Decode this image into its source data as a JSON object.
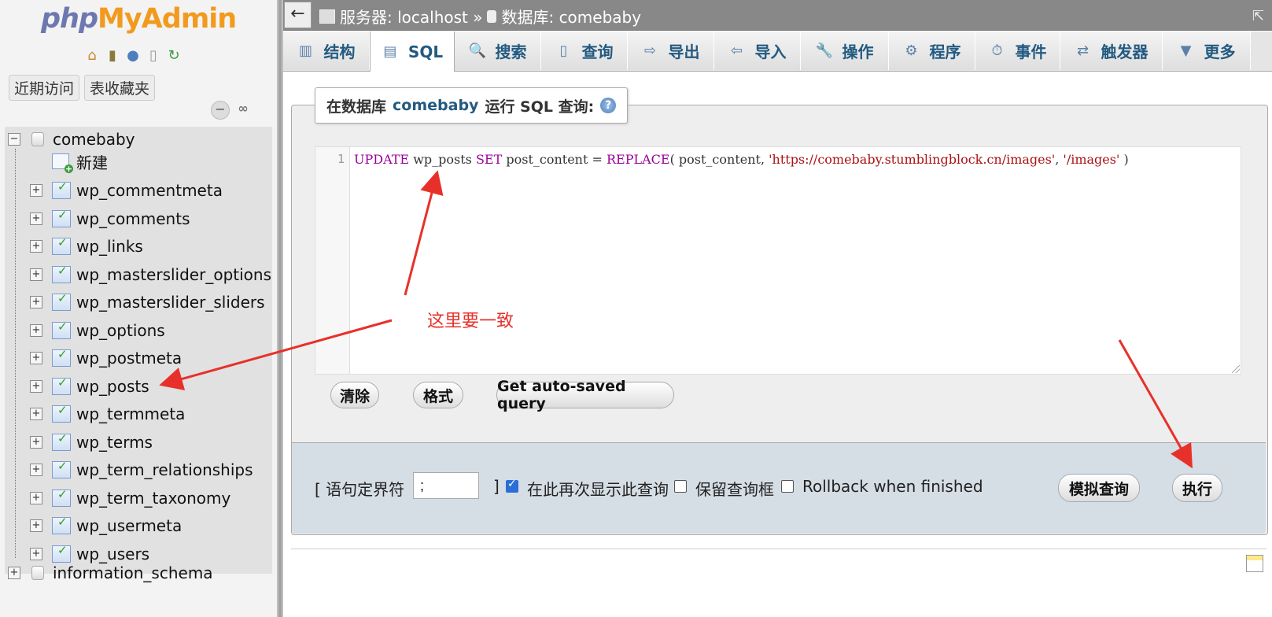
{
  "logo": {
    "part1": "php",
    "part2": "MyAdmin"
  },
  "nav": {
    "tabs": [
      "近期访问",
      "表收藏夹"
    ],
    "databases": [
      {
        "name": "comebaby",
        "new_label": "新建",
        "tables": [
          "wp_commentmeta",
          "wp_comments",
          "wp_links",
          "wp_masterslider_options",
          "wp_masterslider_sliders",
          "wp_options",
          "wp_postmeta",
          "wp_posts",
          "wp_termmeta",
          "wp_terms",
          "wp_term_relationships",
          "wp_term_taxonomy",
          "wp_usermeta",
          "wp_users"
        ]
      },
      {
        "name": "information_schema"
      }
    ]
  },
  "topbar": {
    "back_icon": "←",
    "server_label": "服务器: localhost »",
    "db_label": "数据库: comebaby"
  },
  "tabs": [
    {
      "label": "结构",
      "icon": "structure-icon",
      "glyph": "▥"
    },
    {
      "label": "SQL",
      "icon": "sql-icon",
      "glyph": "▤",
      "active": true
    },
    {
      "label": "搜索",
      "icon": "search-icon",
      "glyph": "🔍"
    },
    {
      "label": "查询",
      "icon": "query-icon",
      "glyph": "▯"
    },
    {
      "label": "导出",
      "icon": "export-icon",
      "glyph": "⇨"
    },
    {
      "label": "导入",
      "icon": "import-icon",
      "glyph": "⇦"
    },
    {
      "label": "操作",
      "icon": "wrench-icon",
      "glyph": "🔧"
    },
    {
      "label": "程序",
      "icon": "routines-icon",
      "glyph": "⚙"
    },
    {
      "label": "事件",
      "icon": "clock-icon",
      "glyph": "⏱"
    },
    {
      "label": "触发器",
      "icon": "trigger-icon",
      "glyph": "⇄"
    },
    {
      "label": "更多",
      "icon": "chevron-down-icon",
      "glyph": "▼"
    }
  ],
  "sql": {
    "legend_prefix": "在数据库",
    "legend_db": "comebaby",
    "legend_suffix": "运行 SQL 查询:",
    "line_number": "1",
    "query": {
      "t1": "UPDATE",
      "t2": " wp_posts ",
      "t3": "SET",
      "t4": " post_content = ",
      "t5": "REPLACE",
      "t6": "( post_content, ",
      "t7": "'https://comebaby.stumblingblock.cn/images'",
      "t8": ", ",
      "t9": "'/images'",
      "t10": " )"
    },
    "buttons": {
      "clear": "清除",
      "format": "格式",
      "autosaved": "Get auto-saved query"
    }
  },
  "options": {
    "delimiter_label": "[ 语句定界符",
    "delimiter_value": ";",
    "delimiter_close": "]",
    "show_again_label": "在此再次显示此查询",
    "show_again_checked": true,
    "retain_box_label": "保留查询框",
    "retain_box_checked": false,
    "rollback_label": "Rollback when finished",
    "rollback_checked": false,
    "simulate_button": "模拟查询",
    "go_button": "执行"
  },
  "annotation": {
    "text": "这里要一致",
    "color": "#e8302a"
  }
}
